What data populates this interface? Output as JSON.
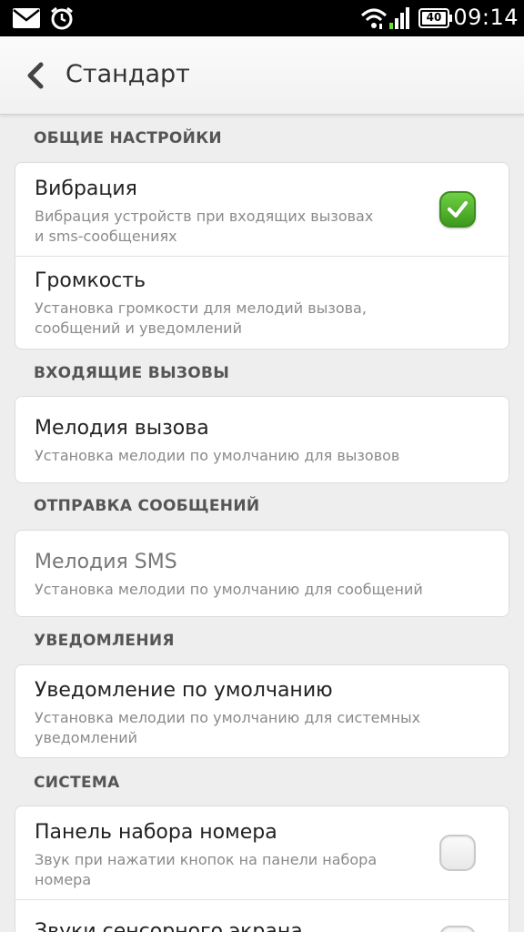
{
  "status_bar": {
    "time": "09:14",
    "battery": "40",
    "icons": [
      "mail-icon",
      "alarm-icon",
      "wifi-icon",
      "signal-icon",
      "battery-icon"
    ]
  },
  "header": {
    "title": "Стандарт",
    "back_icon": "chevron-left-icon"
  },
  "sections": {
    "general": "ОБЩИЕ НАСТРОЙКИ",
    "incoming": "ВХОДЯЩИЕ ВЫЗОВЫ",
    "messages": "ОТПРАВКА СООБЩЕНИЙ",
    "notifications": "УВЕДОМЛЕНИЯ",
    "system": "СИСТЕМА"
  },
  "items": {
    "vibration": {
      "title": "Вибрация",
      "sub1": "Вибрация устройств при входящих вызовах",
      "sub2": "и sms-сообщениях",
      "checked": true
    },
    "volume": {
      "title": "Громкость",
      "sub1": "Установка громкости для мелодий вызова,",
      "sub2": "сообщений и уведомлений"
    },
    "ringtone": {
      "title": "Мелодия вызова",
      "sub1": "Установка мелодии по умолчанию для вызовов"
    },
    "sms_tone": {
      "title": "Мелодия SMS",
      "sub1": "Установка мелодии по умолчанию для сообщений"
    },
    "default_notification": {
      "title": "Уведомление по умолчанию",
      "sub1": "Установка мелодии по умолчанию для системных",
      "sub2": "уведомлений"
    },
    "dialpad": {
      "title": "Панель набора номера",
      "sub1": "Звук при нажатии кнопок на панели набора",
      "sub2": "номера",
      "checked": false
    },
    "touch_sounds": {
      "title": "Звуки сенсорного экрана",
      "checked": false
    }
  },
  "colors": {
    "accent_green": "#4caf2a",
    "header_bg": "#f5f5f5",
    "status_bar_bg": "#000000"
  }
}
